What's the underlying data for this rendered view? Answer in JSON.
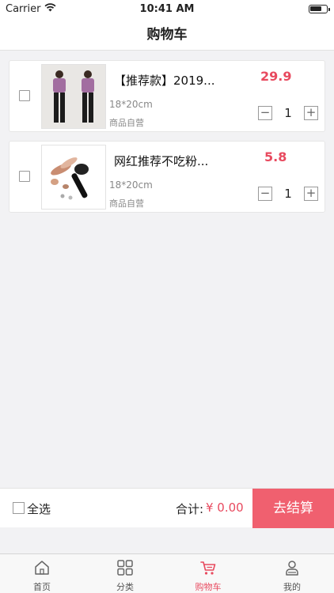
{
  "status_bar": {
    "carrier": "Carrier",
    "time": "10:41 AM",
    "wifi_icon": "wifi-icon",
    "battery_icon": "battery-icon"
  },
  "nav": {
    "title": "购物车"
  },
  "cart": {
    "items": [
      {
        "title": "【推荐款】2019...",
        "price": "29.9",
        "spec": "18*20cm",
        "tag": "商品自营",
        "quantity": "1",
        "thumbnail": "clothing-photo",
        "checked": false
      },
      {
        "title": "网红推荐不吃粉...",
        "price": "5.8",
        "spec": "18*20cm",
        "tag": "商品自营",
        "quantity": "1",
        "thumbnail": "makeup-brush-photo",
        "checked": false
      }
    ]
  },
  "checkout": {
    "select_all_label": "全选",
    "total_label": "合计:",
    "total_value": "¥ 0.00",
    "checkout_label": "去结算"
  },
  "tabs": [
    {
      "label": "首页",
      "icon": "home-icon",
      "active": false
    },
    {
      "label": "分类",
      "icon": "category-grid-icon",
      "active": false
    },
    {
      "label": "购物车",
      "icon": "cart-icon",
      "active": true
    },
    {
      "label": "我的",
      "icon": "profile-icon",
      "active": false
    }
  ],
  "colors": {
    "accent": "#e84a5f",
    "checkout_button": "#f0606f",
    "background": "#f2f2f4"
  }
}
